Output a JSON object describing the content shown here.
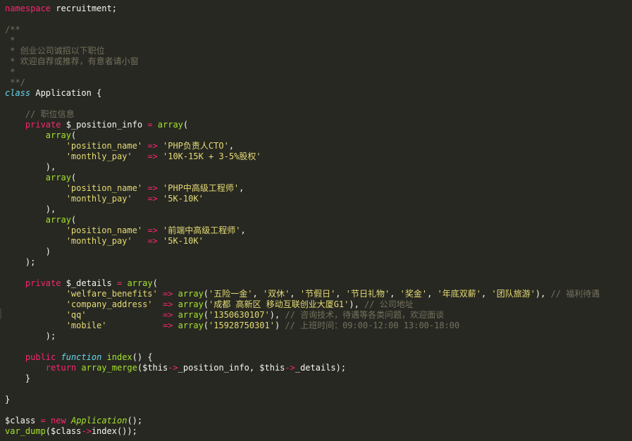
{
  "lines": [
    [
      {
        "t": "namespace",
        "c": "kw"
      },
      {
        "t": " recruitment;",
        "c": "pl"
      }
    ],
    [],
    [
      {
        "t": "/**",
        "c": "cm"
      }
    ],
    [
      {
        "t": " *",
        "c": "cm"
      }
    ],
    [
      {
        "t": " * 创业公司诚招以下职位",
        "c": "cm"
      }
    ],
    [
      {
        "t": " * 欢迎自荐或推荐，有意者请小窗",
        "c": "cm"
      }
    ],
    [
      {
        "t": " *",
        "c": "cm"
      }
    ],
    [
      {
        "t": " **/",
        "c": "cm"
      }
    ],
    [
      {
        "t": "class",
        "c": "sk"
      },
      {
        "t": " Application {",
        "c": "pl"
      }
    ],
    [],
    [
      {
        "t": "    ",
        "c": "pl"
      },
      {
        "t": "// 职位信息",
        "c": "cm"
      }
    ],
    [
      {
        "t": "    ",
        "c": "pl"
      },
      {
        "t": "private",
        "c": "kw"
      },
      {
        "t": " $_position_info ",
        "c": "pl"
      },
      {
        "t": "=",
        "c": "op"
      },
      {
        "t": " ",
        "c": "pl"
      },
      {
        "t": "array",
        "c": "fn"
      },
      {
        "t": "(",
        "c": "pl"
      }
    ],
    [
      {
        "t": "        ",
        "c": "pl"
      },
      {
        "t": "array",
        "c": "fn"
      },
      {
        "t": "(",
        "c": "pl"
      }
    ],
    [
      {
        "t": "            ",
        "c": "pl"
      },
      {
        "t": "'position_name'",
        "c": "str"
      },
      {
        "t": " ",
        "c": "pl"
      },
      {
        "t": "=>",
        "c": "op"
      },
      {
        "t": " ",
        "c": "pl"
      },
      {
        "t": "'PHP负责人CTO'",
        "c": "str"
      },
      {
        "t": ",",
        "c": "pl"
      }
    ],
    [
      {
        "t": "            ",
        "c": "pl"
      },
      {
        "t": "'monthly_pay'",
        "c": "str"
      },
      {
        "t": "   ",
        "c": "pl"
      },
      {
        "t": "=>",
        "c": "op"
      },
      {
        "t": " ",
        "c": "pl"
      },
      {
        "t": "'10K-15K + 3-5%股权'",
        "c": "str"
      }
    ],
    [
      {
        "t": "        ),",
        "c": "pl"
      }
    ],
    [
      {
        "t": "        ",
        "c": "pl"
      },
      {
        "t": "array",
        "c": "fn"
      },
      {
        "t": "(",
        "c": "pl"
      }
    ],
    [
      {
        "t": "            ",
        "c": "pl"
      },
      {
        "t": "'position_name'",
        "c": "str"
      },
      {
        "t": " ",
        "c": "pl"
      },
      {
        "t": "=>",
        "c": "op"
      },
      {
        "t": " ",
        "c": "pl"
      },
      {
        "t": "'PHP中高级工程师'",
        "c": "str"
      },
      {
        "t": ",",
        "c": "pl"
      }
    ],
    [
      {
        "t": "            ",
        "c": "pl"
      },
      {
        "t": "'monthly_pay'",
        "c": "str"
      },
      {
        "t": "   ",
        "c": "pl"
      },
      {
        "t": "=>",
        "c": "op"
      },
      {
        "t": " ",
        "c": "pl"
      },
      {
        "t": "'5K-10K'",
        "c": "str"
      }
    ],
    [
      {
        "t": "        ),",
        "c": "pl"
      }
    ],
    [
      {
        "t": "        ",
        "c": "pl"
      },
      {
        "t": "array",
        "c": "fn"
      },
      {
        "t": "(",
        "c": "pl"
      }
    ],
    [
      {
        "t": "            ",
        "c": "pl"
      },
      {
        "t": "'position_name'",
        "c": "str"
      },
      {
        "t": " ",
        "c": "pl"
      },
      {
        "t": "=>",
        "c": "op"
      },
      {
        "t": " ",
        "c": "pl"
      },
      {
        "t": "'前端中高级工程师'",
        "c": "str"
      },
      {
        "t": ",",
        "c": "pl"
      }
    ],
    [
      {
        "t": "            ",
        "c": "pl"
      },
      {
        "t": "'monthly_pay'",
        "c": "str"
      },
      {
        "t": "   ",
        "c": "pl"
      },
      {
        "t": "=>",
        "c": "op"
      },
      {
        "t": " ",
        "c": "pl"
      },
      {
        "t": "'5K-10K'",
        "c": "str"
      }
    ],
    [
      {
        "t": "        )",
        "c": "pl"
      }
    ],
    [
      {
        "t": "    );",
        "c": "pl"
      }
    ],
    [],
    [
      {
        "t": "    ",
        "c": "pl"
      },
      {
        "t": "private",
        "c": "kw"
      },
      {
        "t": " $_details ",
        "c": "pl"
      },
      {
        "t": "=",
        "c": "op"
      },
      {
        "t": " ",
        "c": "pl"
      },
      {
        "t": "array",
        "c": "fn"
      },
      {
        "t": "(",
        "c": "pl"
      }
    ],
    [
      {
        "t": "            ",
        "c": "pl"
      },
      {
        "t": "'welfare_benefits'",
        "c": "str"
      },
      {
        "t": " ",
        "c": "pl"
      },
      {
        "t": "=>",
        "c": "op"
      },
      {
        "t": " ",
        "c": "pl"
      },
      {
        "t": "array",
        "c": "fn"
      },
      {
        "t": "(",
        "c": "pl"
      },
      {
        "t": "'五险一金'",
        "c": "str"
      },
      {
        "t": ", ",
        "c": "pl"
      },
      {
        "t": "'双休'",
        "c": "str"
      },
      {
        "t": ", ",
        "c": "pl"
      },
      {
        "t": "'节假日'",
        "c": "str"
      },
      {
        "t": ", ",
        "c": "pl"
      },
      {
        "t": "'节日礼物'",
        "c": "str"
      },
      {
        "t": ", ",
        "c": "pl"
      },
      {
        "t": "'奖金'",
        "c": "str"
      },
      {
        "t": ", ",
        "c": "pl"
      },
      {
        "t": "'年底双薪'",
        "c": "str"
      },
      {
        "t": ", ",
        "c": "pl"
      },
      {
        "t": "'团队旅游'",
        "c": "str"
      },
      {
        "t": "), ",
        "c": "pl"
      },
      {
        "t": "// 福利待遇",
        "c": "cm"
      }
    ],
    [
      {
        "t": "            ",
        "c": "pl"
      },
      {
        "t": "'company_address'",
        "c": "str"
      },
      {
        "t": "  ",
        "c": "pl"
      },
      {
        "t": "=>",
        "c": "op"
      },
      {
        "t": " ",
        "c": "pl"
      },
      {
        "t": "array",
        "c": "fn"
      },
      {
        "t": "(",
        "c": "pl"
      },
      {
        "t": "'成都 高新区 移动互联创业大厦G1'",
        "c": "str"
      },
      {
        "t": "), ",
        "c": "pl"
      },
      {
        "t": "// 公司地址",
        "c": "cm"
      }
    ],
    [
      {
        "t": "            ",
        "c": "pl"
      },
      {
        "t": "'qq'",
        "c": "str"
      },
      {
        "t": "               ",
        "c": "pl"
      },
      {
        "t": "=>",
        "c": "op"
      },
      {
        "t": " ",
        "c": "pl"
      },
      {
        "t": "array",
        "c": "fn"
      },
      {
        "t": "(",
        "c": "pl"
      },
      {
        "t": "'1350630107'",
        "c": "str"
      },
      {
        "t": "), ",
        "c": "pl"
      },
      {
        "t": "// 咨询技术，待遇等各类问题，欢迎面谈",
        "c": "cm"
      }
    ],
    [
      {
        "t": "            ",
        "c": "pl"
      },
      {
        "t": "'mobile'",
        "c": "str"
      },
      {
        "t": "           ",
        "c": "pl"
      },
      {
        "t": "=>",
        "c": "op"
      },
      {
        "t": " ",
        "c": "pl"
      },
      {
        "t": "array",
        "c": "fn"
      },
      {
        "t": "(",
        "c": "pl"
      },
      {
        "t": "'15928750301'",
        "c": "str"
      },
      {
        "t": ") ",
        "c": "pl"
      },
      {
        "t": "// 上班时间：09:00-12:00 13:00-18:00",
        "c": "cm"
      }
    ],
    [
      {
        "t": "        );",
        "c": "pl"
      }
    ],
    [],
    [
      {
        "t": "    ",
        "c": "pl"
      },
      {
        "t": "public",
        "c": "kw"
      },
      {
        "t": " ",
        "c": "pl"
      },
      {
        "t": "function",
        "c": "sk"
      },
      {
        "t": " ",
        "c": "pl"
      },
      {
        "t": "index",
        "c": "fn"
      },
      {
        "t": "() {",
        "c": "pl"
      }
    ],
    [
      {
        "t": "        ",
        "c": "pl"
      },
      {
        "t": "return",
        "c": "kw"
      },
      {
        "t": " ",
        "c": "pl"
      },
      {
        "t": "array_merge",
        "c": "fn"
      },
      {
        "t": "($this",
        "c": "pl"
      },
      {
        "t": "->",
        "c": "op"
      },
      {
        "t": "_position_info, $this",
        "c": "pl"
      },
      {
        "t": "->",
        "c": "op"
      },
      {
        "t": "_details);",
        "c": "pl"
      }
    ],
    [
      {
        "t": "    }",
        "c": "pl"
      }
    ],
    [],
    [
      {
        "t": "}",
        "c": "pl"
      }
    ],
    [],
    [
      {
        "t": "$class ",
        "c": "pl"
      },
      {
        "t": "=",
        "c": "op"
      },
      {
        "t": " ",
        "c": "pl"
      },
      {
        "t": "new",
        "c": "kw"
      },
      {
        "t": " ",
        "c": "pl"
      },
      {
        "t": "Application",
        "c": "cls"
      },
      {
        "t": "();",
        "c": "pl"
      }
    ],
    [
      {
        "t": "var_dump",
        "c": "fn"
      },
      {
        "t": "($class",
        "c": "pl"
      },
      {
        "t": "->",
        "c": "op"
      },
      {
        "t": "index());",
        "c": "pl"
      }
    ]
  ]
}
